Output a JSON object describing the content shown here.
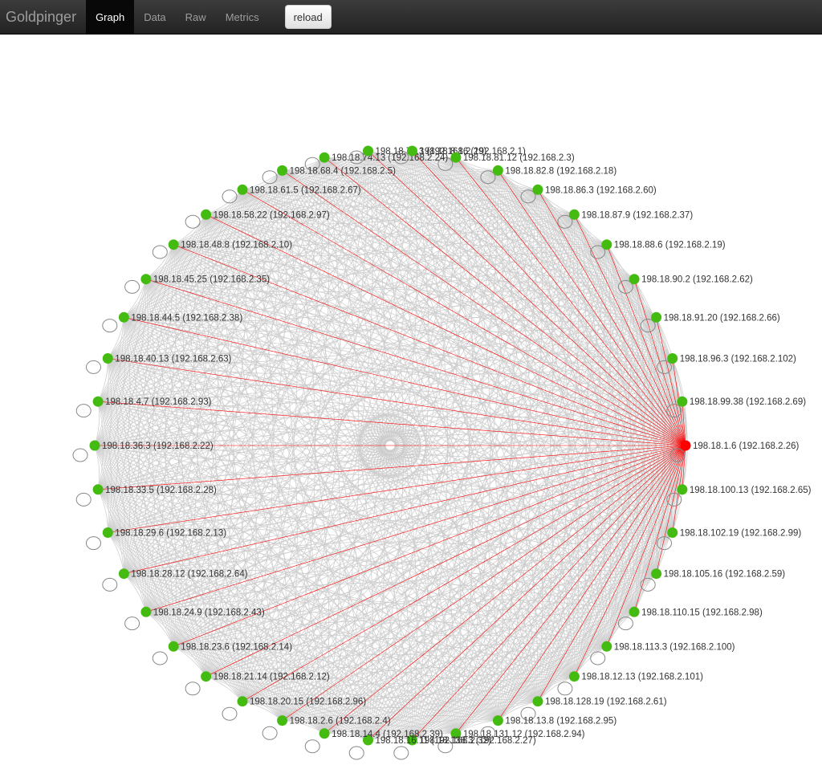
{
  "navbar": {
    "brand": "Goldpinger",
    "tabs": [
      {
        "label": "Graph",
        "active": true
      },
      {
        "label": "Data",
        "active": false
      },
      {
        "label": "Raw",
        "active": false
      },
      {
        "label": "Metrics",
        "active": false
      }
    ],
    "reload_label": "reload"
  },
  "graph": {
    "colors": {
      "healthy_node": "#44bb11",
      "unhealthy_node": "#ff0000",
      "edge_ok": "#cccccc",
      "edge_error": "#ff0000",
      "self_loop": "#888888"
    },
    "nodes": [
      {
        "label": "198.18.1.6 (192.168.2.26)",
        "status": "unhealthy"
      },
      {
        "label": "198.18.100.13 (192.168.2.65)",
        "status": "healthy"
      },
      {
        "label": "198.18.102.19 (192.168.2.99)",
        "status": "healthy"
      },
      {
        "label": "198.18.105.16 (192.168.2.59)",
        "status": "healthy"
      },
      {
        "label": "198.18.110.15 (192.168.2.98)",
        "status": "healthy"
      },
      {
        "label": "198.18.113.3 (192.168.2.100)",
        "status": "healthy"
      },
      {
        "label": "198.18.12.13 (192.168.2.101)",
        "status": "healthy"
      },
      {
        "label": "198.18.128.19 (192.168.2.61)",
        "status": "healthy"
      },
      {
        "label": "198.18.13.8 (192.168.2.95)",
        "status": "healthy"
      },
      {
        "label": "198.18.131.12 (192.168.2.94)",
        "status": "healthy"
      },
      {
        "label": "198.18.138.3 (192.168.2.27)",
        "status": "healthy"
      },
      {
        "label": "198.18.16.11 (192.168.2.32)",
        "status": "healthy"
      },
      {
        "label": "198.18.14.4 (192.168.2.39)",
        "status": "healthy"
      },
      {
        "label": "198.18.2.6 (192.168.2.4)",
        "status": "healthy"
      },
      {
        "label": "198.18.20.15 (192.168.2.96)",
        "status": "healthy"
      },
      {
        "label": "198.18.21.14 (192.168.2.12)",
        "status": "healthy"
      },
      {
        "label": "198.18.23.6 (192.168.2.14)",
        "status": "healthy"
      },
      {
        "label": "198.18.24.9 (192.168.2.43)",
        "status": "healthy"
      },
      {
        "label": "198.18.28.12 (192.168.2.64)",
        "status": "healthy"
      },
      {
        "label": "198.18.29.6 (192.168.2.13)",
        "status": "healthy"
      },
      {
        "label": "198.18.33.5 (192.168.2.28)",
        "status": "healthy"
      },
      {
        "label": "198.18.36.3 (192.168.2.22)",
        "status": "healthy"
      },
      {
        "label": "198.18.4.7 (192.168.2.93)",
        "status": "healthy"
      },
      {
        "label": "198.18.40.13 (192.168.2.63)",
        "status": "healthy"
      },
      {
        "label": "198.18.44.5 (192.168.2.38)",
        "status": "healthy"
      },
      {
        "label": "198.18.45.25 (192.168.2.35)",
        "status": "healthy"
      },
      {
        "label": "198.18.48.8 (192.168.2.10)",
        "status": "healthy"
      },
      {
        "label": "198.18.58.22 (192.168.2.97)",
        "status": "healthy"
      },
      {
        "label": "198.18.61.5 (192.168.2.67)",
        "status": "healthy"
      },
      {
        "label": "198.18.68.4 (192.168.2.5)",
        "status": "healthy"
      },
      {
        "label": "198.18.74.13 (192.168.2.24)",
        "status": "healthy"
      },
      {
        "label": "198.18.75.3 (192.168.2.29)",
        "status": "healthy"
      },
      {
        "label": "198.18.8.16 (192.168.2.1)",
        "status": "healthy"
      },
      {
        "label": "198.18.81.12 (192.168.2.3)",
        "status": "healthy"
      },
      {
        "label": "198.18.82.8 (192.168.2.18)",
        "status": "healthy"
      },
      {
        "label": "198.18.86.3 (192.168.2.60)",
        "status": "healthy"
      },
      {
        "label": "198.18.87.9 (192.168.2.37)",
        "status": "healthy"
      },
      {
        "label": "198.18.88.6 (192.168.2.19)",
        "status": "healthy"
      },
      {
        "label": "198.18.90.2 (192.168.2.62)",
        "status": "healthy"
      },
      {
        "label": "198.18.91.20 (192.168.2.66)",
        "status": "healthy"
      },
      {
        "label": "198.18.96.3 (192.168.2.102)",
        "status": "healthy"
      },
      {
        "label": "198.18.99.38 (192.168.2.69)",
        "status": "healthy"
      }
    ]
  }
}
